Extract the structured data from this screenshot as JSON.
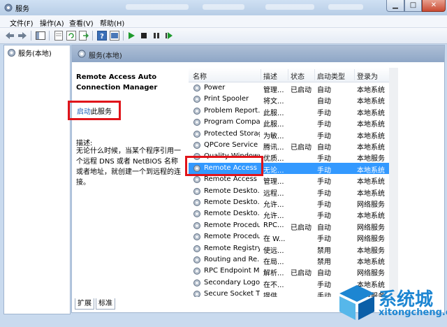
{
  "window": {
    "title": "服务"
  },
  "menu": [
    "文件(F)",
    "操作(A)",
    "查看(V)",
    "帮助(H)"
  ],
  "tree": {
    "root_label": "服务(本地)"
  },
  "main": {
    "header": "服务(本地)",
    "service_title": "Remote Access Auto Connection Manager",
    "start_link": "启动",
    "start_suffix": "此服务",
    "desc_label": "描述:",
    "desc_text": "无论什么时候，当某个程序引用一个远程 DNS 或者 NetBIOS 名称或者地址，就创建一个到远程的连接。"
  },
  "columns": [
    "名称",
    "描述",
    "状态",
    "启动类型",
    "登录为"
  ],
  "services": [
    {
      "name": "Power",
      "desc": "管理...",
      "status": "已启动",
      "startup": "自动",
      "logon": "本地系统"
    },
    {
      "name": "Print Spooler",
      "desc": "将文...",
      "status": "",
      "startup": "自动",
      "logon": "本地系统"
    },
    {
      "name": "Problem Report...",
      "desc": "此服...",
      "status": "",
      "startup": "手动",
      "logon": "本地系统"
    },
    {
      "name": "Program Compa...",
      "desc": "此服...",
      "status": "",
      "startup": "手动",
      "logon": "本地系统"
    },
    {
      "name": "Protected Storage",
      "desc": "为敏...",
      "status": "",
      "startup": "手动",
      "logon": "本地系统"
    },
    {
      "name": "QPCore Service",
      "desc": "腾讯...",
      "status": "已启动",
      "startup": "自动",
      "logon": "本地系统"
    },
    {
      "name": "Quality Windows...",
      "desc": "优质...",
      "status": "",
      "startup": "手动",
      "logon": "本地服务"
    },
    {
      "name": "Remote Access ...",
      "desc": "无论...",
      "status": "",
      "startup": "手动",
      "logon": "本地系统",
      "selected": true
    },
    {
      "name": "Remote Access ...",
      "desc": "管理...",
      "status": "",
      "startup": "手动",
      "logon": "本地系统"
    },
    {
      "name": "Remote Deskto...",
      "desc": "远程...",
      "status": "",
      "startup": "手动",
      "logon": "本地系统"
    },
    {
      "name": "Remote Deskto...",
      "desc": "允许...",
      "status": "",
      "startup": "手动",
      "logon": "网络服务"
    },
    {
      "name": "Remote Deskto...",
      "desc": "允许...",
      "status": "",
      "startup": "手动",
      "logon": "本地系统"
    },
    {
      "name": "Remote Procedu...",
      "desc": "RPC...",
      "status": "已启动",
      "startup": "自动",
      "logon": "网络服务"
    },
    {
      "name": "Remote Procedu...",
      "desc": "在 W...",
      "status": "",
      "startup": "手动",
      "logon": "网络服务"
    },
    {
      "name": "Remote Registry",
      "desc": "使远...",
      "status": "",
      "startup": "禁用",
      "logon": "本地服务"
    },
    {
      "name": "Routing and Re...",
      "desc": "在局...",
      "status": "",
      "startup": "禁用",
      "logon": "本地系统"
    },
    {
      "name": "RPC Endpoint M...",
      "desc": "解析...",
      "status": "已启动",
      "startup": "自动",
      "logon": "网络服务"
    },
    {
      "name": "Secondary Logon",
      "desc": "在不...",
      "status": "",
      "startup": "手动",
      "logon": "本地系统"
    },
    {
      "name": "Secure Socket T...",
      "desc": "提供...",
      "status": "",
      "startup": "手动",
      "logon": "本地服务"
    }
  ],
  "tabs": [
    "扩展",
    "标准"
  ],
  "watermark": {
    "text": "系统城",
    "sub": "xitongcheng.com"
  },
  "colors": {
    "selected": "#3399ff",
    "highlight": "#e0141a",
    "link": "#1b5eb8"
  }
}
